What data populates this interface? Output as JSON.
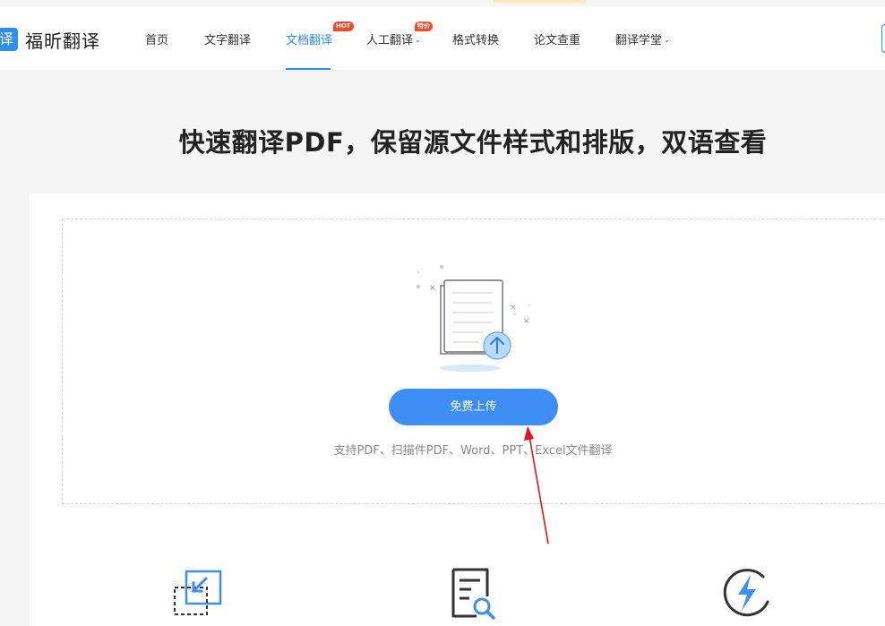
{
  "header": {
    "logo_badge": "译",
    "logo_text": "福昕翻译",
    "nav": [
      {
        "label": "首页"
      },
      {
        "label": "文字翻译"
      },
      {
        "label": "文档翻译",
        "badge": "HOT"
      },
      {
        "label": "人工翻译",
        "badge": "特价"
      },
      {
        "label": "格式转换"
      },
      {
        "label": "论文查重"
      },
      {
        "label": "翻译学堂"
      }
    ]
  },
  "headline": "快速翻译PDF，保留源文件样式和排版，双语查看",
  "upload": {
    "button_label": "免费上传",
    "support_text": "支持PDF、扫描件PDF、Word、PPT、Excel文件翻译"
  },
  "colors": {
    "accent": "#2e8ef0",
    "button": "#3f8ef5",
    "badge": "#f04a2a",
    "annotation_arrow": "#e0161e"
  },
  "icons": [
    "document-upload-icon",
    "import-file-icon",
    "document-search-icon",
    "lightning-icon",
    "chevron-down-icon"
  ]
}
